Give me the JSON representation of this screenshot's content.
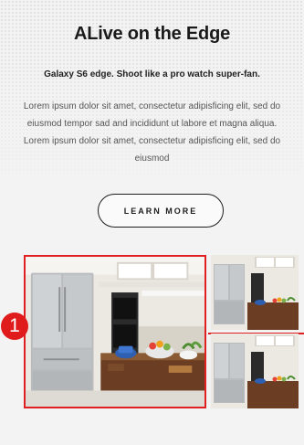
{
  "hero": {
    "headline": "ALive on the Edge",
    "subhead": "Galaxy S6 edge. Shoot like a pro watch super-fan.",
    "body": "Lorem ipsum dolor sit amet, consectetur adipisficing elit, sed do eiusmod tempor sad and incididunt ut labore et magna aliqua. Lorem ipsum dolor sit amet, consectetur adipisficing elit, sed do eiusmod",
    "cta_label": "LEARN MORE"
  },
  "gallery": {
    "main_image_icon": "kitchen-refrigerator-image",
    "thumbnail_icons": [
      "kitchen-refrigerator-thumbnail",
      "kitchen-refrigerator-thumbnail"
    ],
    "highlight_color": "#e02020"
  },
  "annotation": {
    "step_number": "1",
    "color": "#e01b1b"
  }
}
